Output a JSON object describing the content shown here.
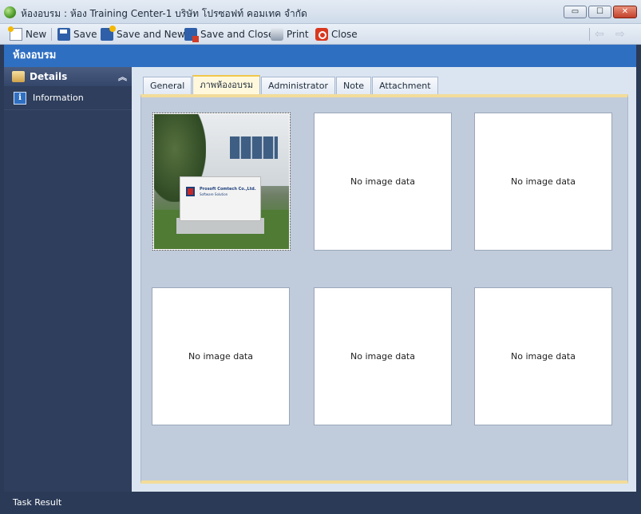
{
  "window": {
    "title": "ห้องอบรม : ห้อง Training Center-1 บริษัท โปรซอฟท์ คอมเทค จำกัด",
    "app_icon": "globe-recycle-icon",
    "controls": {
      "minimize": "▭",
      "maximize": "☐",
      "close": "✕"
    }
  },
  "toolbar": {
    "new_label": "New",
    "save_label": "Save",
    "save_new_label": "Save and New",
    "save_close_label": "Save and Close",
    "print_label": "Print",
    "close_label": "Close",
    "back_arrow": "⇦",
    "forward_arrow": "⇨"
  },
  "header": {
    "title": "ห้องอบรม"
  },
  "sidebar": {
    "group_title": "Details",
    "collapse_glyph": "︽",
    "items": [
      {
        "label": "Information",
        "icon": "info-icon",
        "glyph": "i"
      }
    ]
  },
  "tabs": [
    {
      "label": "General",
      "active": false
    },
    {
      "label": "ภาพห้องอบรม",
      "active": true
    },
    {
      "label": "Administrator",
      "active": false
    },
    {
      "label": "Note",
      "active": false
    },
    {
      "label": "Attachment",
      "active": false
    }
  ],
  "gallery": {
    "photo": {
      "sign_line1": "Prosoft Comtech Co.,Ltd.",
      "sign_line2": "Software Solution"
    },
    "empty_text": [
      "No image data",
      "No image data",
      "No image data",
      "No image data",
      "No image data"
    ]
  },
  "status": {
    "text": "Task Result"
  },
  "colors": {
    "header_blue": "#2f6fc2",
    "sidebar_bg": "#2e3e5c",
    "panel_accent": "#f2dc9a",
    "close_red": "#c3412a"
  }
}
